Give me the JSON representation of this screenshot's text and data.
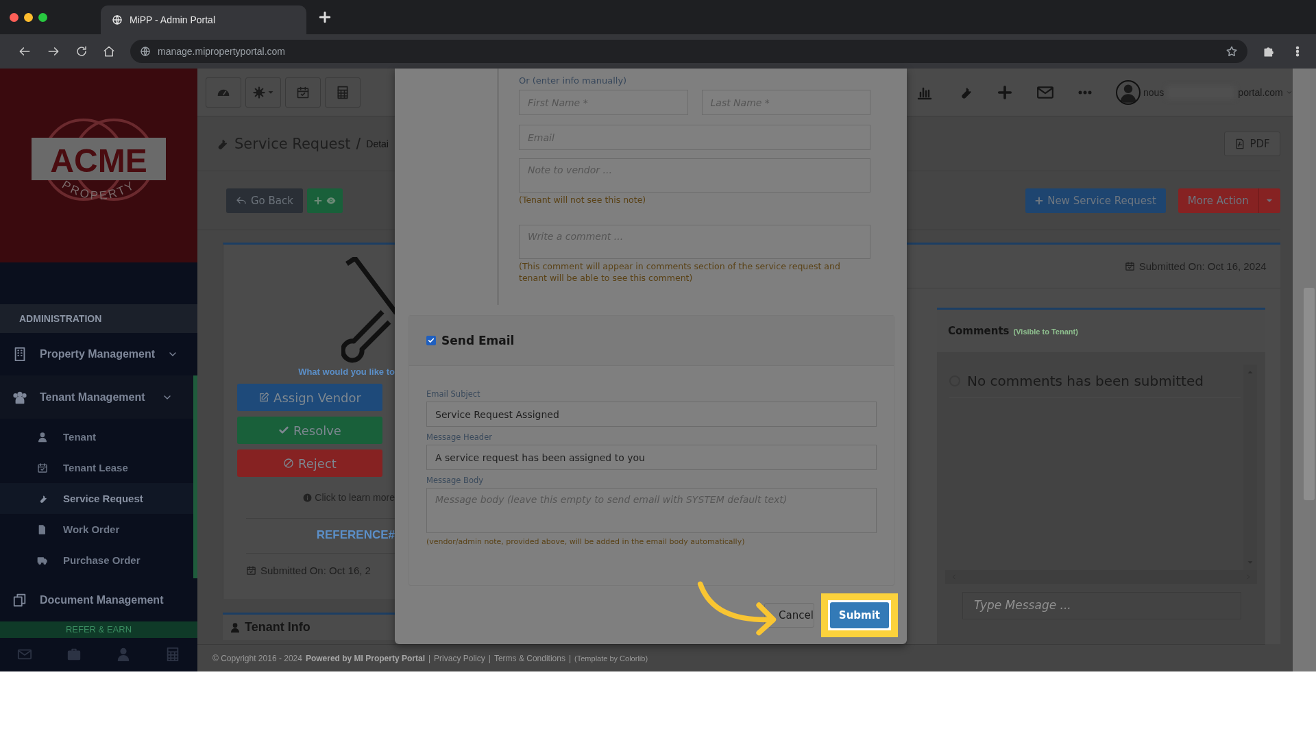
{
  "browser": {
    "tab_title": "MiPP - Admin Portal",
    "url": "manage.mipropertyportal.com"
  },
  "sidebar": {
    "logo": {
      "brand": "ACME",
      "sub": "PROPERTY"
    },
    "section": "ADMINISTRATION",
    "items": [
      {
        "label": "Property Management",
        "expanded": false,
        "selected": false
      },
      {
        "label": "Tenant Management",
        "expanded": true,
        "selected": true,
        "children": [
          {
            "label": "Tenant",
            "selected": false
          },
          {
            "label": "Tenant Lease",
            "selected": false
          },
          {
            "label": "Service Request",
            "selected": true
          },
          {
            "label": "Work Order",
            "selected": false
          },
          {
            "label": "Purchase Order",
            "selected": false
          }
        ]
      },
      {
        "label": "Document Management",
        "expanded": false,
        "selected": false
      }
    ],
    "refer": "REFER & EARN"
  },
  "page": {
    "title": "Service Request",
    "separator": "/",
    "crumb": "Detai",
    "go_back": "Go Back",
    "detail": {
      "prompt": "What would you like to",
      "actions": [
        {
          "label": "Assign Vendor",
          "kind": "primary"
        },
        {
          "label": "Resolve",
          "kind": "success"
        },
        {
          "label": "Reject",
          "kind": "danger"
        }
      ],
      "learn_more": "Click to learn more",
      "reference": "REFERENCE#",
      "submitted": "Submitted On: Oct 16, 2"
    },
    "tenant_info": "Tenant Info",
    "user": {
      "name_start": "nous",
      "name_end": "portal.com"
    },
    "pdf": "PDF",
    "new_request": "New Service Request",
    "more_action": "More Action",
    "submitted_on": "Submitted On: Oct 16, 2024",
    "comments": {
      "title": "Comments",
      "note": "(Visible to Tenant)",
      "empty": "No comments has been submitted",
      "message_placeholder": "Type Message ..."
    }
  },
  "modal": {
    "manual_label": "Or (enter info manually)",
    "first_name": {
      "placeholder": "First Name *"
    },
    "last_name": {
      "placeholder": "Last Name *"
    },
    "email": {
      "placeholder": "Email"
    },
    "note": {
      "placeholder": "Note to vendor ..."
    },
    "note_hint": "(Tenant will not see this note)",
    "comment": {
      "placeholder": "Write a comment ..."
    },
    "comment_hint": "(This comment will appear in comments section of the service request and tenant will be able to see this comment)",
    "send_email": {
      "label": "Send Email",
      "checked": true
    },
    "subject": {
      "label": "Email Subject",
      "value": "Service Request Assigned"
    },
    "header": {
      "label": "Message Header",
      "value": "A service request has been assigned to you"
    },
    "body": {
      "label": "Message Body",
      "placeholder": "Message body (leave this empty to send email with SYSTEM default text)"
    },
    "body_hint": "(vendor/admin note, provided above, will be added in the email body automatically)",
    "cancel": "Cancel",
    "submit": "Submit"
  },
  "footer": {
    "separator": "|",
    "copyright": "© Copyright 2016 - 2024",
    "powered": "Powered by MI Property Portal",
    "privacy": "Privacy Policy",
    "terms": "Terms & Conditions",
    "template": "(Template by Colorlib)"
  }
}
